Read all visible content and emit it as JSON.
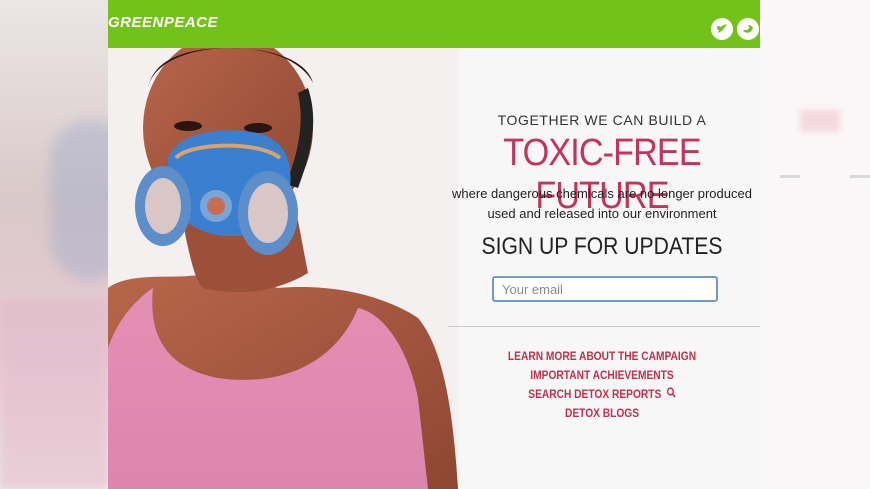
{
  "header": {
    "logo": "GREENPEACE",
    "social": [
      {
        "icon": "social-icon-1"
      },
      {
        "icon": "social-icon-2"
      }
    ]
  },
  "hero": {
    "image": "woman-wearing-gas-mask-photo",
    "pre_title": "TOGETHER WE CAN BUILD A",
    "title": "TOXIC-FREE FUTURE",
    "description_line1": "where dangerous chemicals are no longer produced",
    "description_line2": "used and released into our environment"
  },
  "signup": {
    "heading": "SIGN UP FOR UPDATES",
    "email_placeholder": "Your email"
  },
  "links": [
    {
      "label": "LEARN MORE ABOUT THE CAMPAIGN"
    },
    {
      "label": "IMPORTANT ACHIEVEMENTS"
    },
    {
      "label": "SEARCH DETOX REPORTS",
      "icon": "search-icon"
    },
    {
      "label": "DETOX BLOGS"
    }
  ],
  "colors": {
    "header_green": "#73c21a",
    "title_pink": "#c2345c",
    "link_red": "#c0304d",
    "input_border": "#6f9bc6"
  }
}
